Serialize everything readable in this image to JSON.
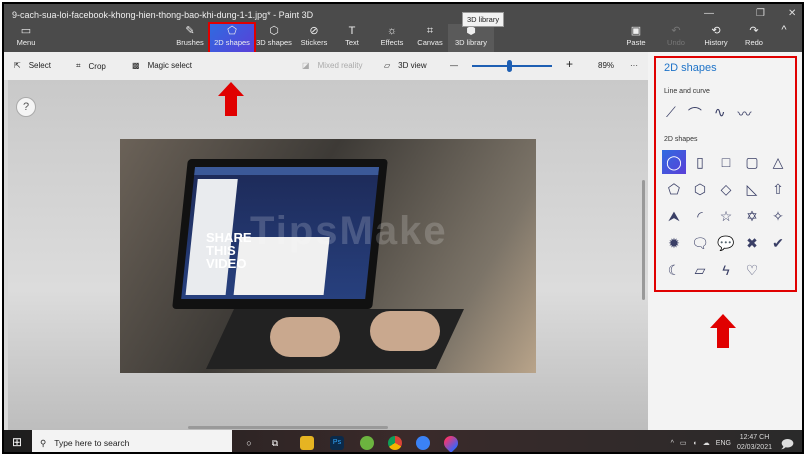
{
  "window": {
    "title": "9-cach-sua-loi-facebook-khong-hien-thong-bao-khi-dung-1-1.jpg* - Paint 3D",
    "minimize": "—",
    "restore": "❐",
    "close": "✕"
  },
  "menu": {
    "label": "Menu",
    "icon": "folder-icon"
  },
  "tools": [
    {
      "label": "Brushes",
      "icon": "✎"
    },
    {
      "label": "2D shapes",
      "icon": "⬠"
    },
    {
      "label": "3D shapes",
      "icon": "⬡"
    },
    {
      "label": "Stickers",
      "icon": "⊘"
    },
    {
      "label": "Text",
      "icon": "T"
    },
    {
      "label": "Effects",
      "icon": "☼"
    },
    {
      "label": "Canvas",
      "icon": "⌗"
    },
    {
      "label": "3D library",
      "icon": "⬢"
    }
  ],
  "tooltip": "3D library",
  "right_tools": {
    "paste": "Paste",
    "undo": "Undo",
    "history": "History",
    "redo": "Redo",
    "collapse": "^"
  },
  "subbar": {
    "select": "Select",
    "crop": "Crop",
    "magic_select": "Magic select",
    "mixed_reality": "Mixed reality",
    "view3d": "3D view",
    "zoom_out": "—",
    "zoom_in": "+",
    "zoom": "89%",
    "more": "···",
    "zoom_level_percent": 89
  },
  "canvas": {
    "help": "?",
    "watermark": "TipsMake",
    "photo_text": "SHARE THIS VIDEO"
  },
  "panel": {
    "title": "2D shapes",
    "line_section": "Line and curve",
    "lines": [
      "⟋",
      "⌒",
      "∿",
      "〰"
    ],
    "shape_section": "2D shapes",
    "shapes": [
      "◯",
      "▯",
      "□",
      "▢",
      "△",
      "⬠",
      "⬡",
      "◇",
      "◺",
      "⇧",
      "⮝",
      "◜",
      "☆",
      "✡",
      "✧",
      "✹",
      "🗨",
      "💬",
      "✖",
      "✔",
      "☾",
      "▱",
      "ϟ",
      "♡"
    ]
  },
  "taskbar": {
    "search_placeholder": "Type here to search",
    "time": "12:47 CH",
    "date": "02/03/2021",
    "lang": "ENG"
  },
  "colors": {
    "accent": "#2f6be0",
    "annotation": "#e00000",
    "panel_title": "#1e73c8"
  }
}
